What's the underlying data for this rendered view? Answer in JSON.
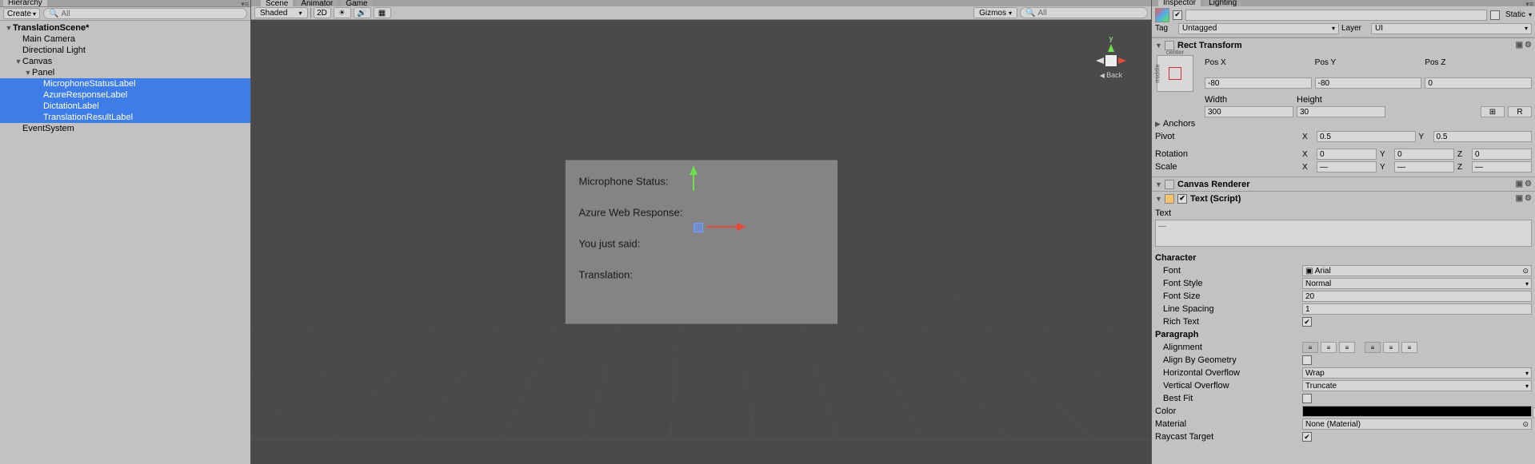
{
  "hierarchy": {
    "tab": "Hierarchy",
    "create": "Create",
    "search_ph": "All",
    "root": "TranslationScene*",
    "items": [
      "Main Camera",
      "Directional Light",
      "Canvas",
      "Panel",
      "MicrophoneStatusLabel",
      "AzureResponseLabel",
      "DictationLabel",
      "TranslationResultLabel",
      "EventSystem"
    ]
  },
  "scene": {
    "tabs": [
      "Scene",
      "Animator",
      "Game"
    ],
    "shaded": "Shaded",
    "mode2d": "2D",
    "gizmos": "Gizmos",
    "search_ph": "All",
    "back": "Back",
    "panel_labels": [
      "Microphone Status:",
      "Azure Web Response:",
      "You just said:",
      "Translation:"
    ],
    "axis_y": "y"
  },
  "inspector": {
    "tabs": [
      "Inspector",
      "Lighting"
    ],
    "name": "",
    "static": "Static",
    "tag_lbl": "Tag",
    "tag_val": "Untagged",
    "layer_lbl": "Layer",
    "layer_val": "UI",
    "rect": {
      "title": "Rect Transform",
      "anchor_center": "center",
      "anchor_middle": "middle",
      "posx_lbl": "Pos X",
      "posx": "-80",
      "posy_lbl": "Pos Y",
      "posy": "-80",
      "posz_lbl": "Pos Z",
      "posz": "0",
      "w_lbl": "Width",
      "w": "300",
      "h_lbl": "Height",
      "h": "30",
      "r_btn": "R",
      "anchors": "Anchors",
      "pivot": "Pivot",
      "px": "0.5",
      "py": "0.5",
      "rotation": "Rotation",
      "rx": "0",
      "ry": "0",
      "rz": "0",
      "scale": "Scale",
      "sx": "—",
      "sy": "—",
      "sz": "—"
    },
    "canvasr": {
      "title": "Canvas Renderer"
    },
    "text": {
      "title": "Text (Script)",
      "text_lbl": "Text",
      "text_val": "—",
      "char": "Character",
      "font_lbl": "Font",
      "font": "Arial",
      "style_lbl": "Font Style",
      "style": "Normal",
      "size_lbl": "Font Size",
      "size": "20",
      "spacing_lbl": "Line Spacing",
      "spacing": "1",
      "rich_lbl": "Rich Text",
      "para": "Paragraph",
      "align_lbl": "Alignment",
      "geo_lbl": "Align By Geometry",
      "ho_lbl": "Horizontal Overflow",
      "ho": "Wrap",
      "vo_lbl": "Vertical Overflow",
      "vo": "Truncate",
      "fit_lbl": "Best Fit",
      "color_lbl": "Color",
      "mat_lbl": "Material",
      "mat": "None (Material)",
      "ray_lbl": "Raycast Target"
    }
  }
}
